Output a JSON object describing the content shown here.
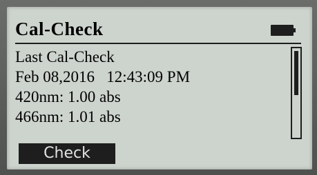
{
  "screen": {
    "title": "Cal-Check",
    "battery_icon": "battery-full-icon"
  },
  "main": {
    "lines": [
      "Last Cal-Check",
      "Feb 08,2016   12:43:09 PM",
      "420nm: 1.00 abs",
      "466nm: 1.01 abs"
    ],
    "scroll_position": 0.0
  },
  "softkeys": {
    "left_label": "Check"
  },
  "colors": {
    "lcd_background": "#cdd3cd",
    "lcd_foreground": "#1e1e1e",
    "bezel": "#5a5c5a"
  }
}
